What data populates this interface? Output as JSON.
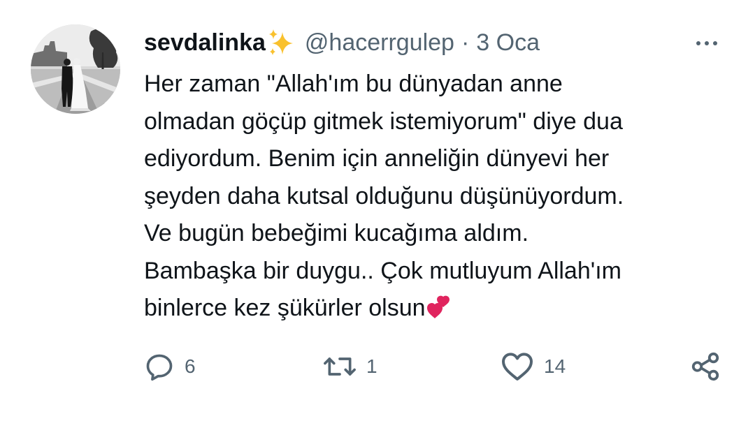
{
  "tweet": {
    "author": {
      "display_name": "sevdalinka",
      "handle": "@hacerrgulep",
      "avatar_icon": "couple-photo-avatar",
      "name_emoji": "sparkles-icon"
    },
    "separator": "·",
    "timestamp": "3 Oca",
    "text_lines": [
      "Her zaman \"Allah'ım bu dünyadan anne",
      "olmadan göçüp gitmek istemiyorum\" diye dua",
      "ediyordum. Benim için anneliğin dünyevi her",
      "şeyden daha kutsal olduğunu düşünüyordum.",
      "Ve bugün bebeğimi kucağıma aldım.",
      "Bambaşka bir duygu.. Çok mutluyum Allah'ım",
      "binlerce kez şükürler olsun"
    ],
    "text_emoji": "two-hearts-icon",
    "actions": {
      "replies": "6",
      "retweets": "1",
      "likes": "14"
    }
  },
  "colors": {
    "text": "#0f1419",
    "secondary": "#536471",
    "heart": "#e0245e",
    "sparkle": "#f9c12e"
  }
}
